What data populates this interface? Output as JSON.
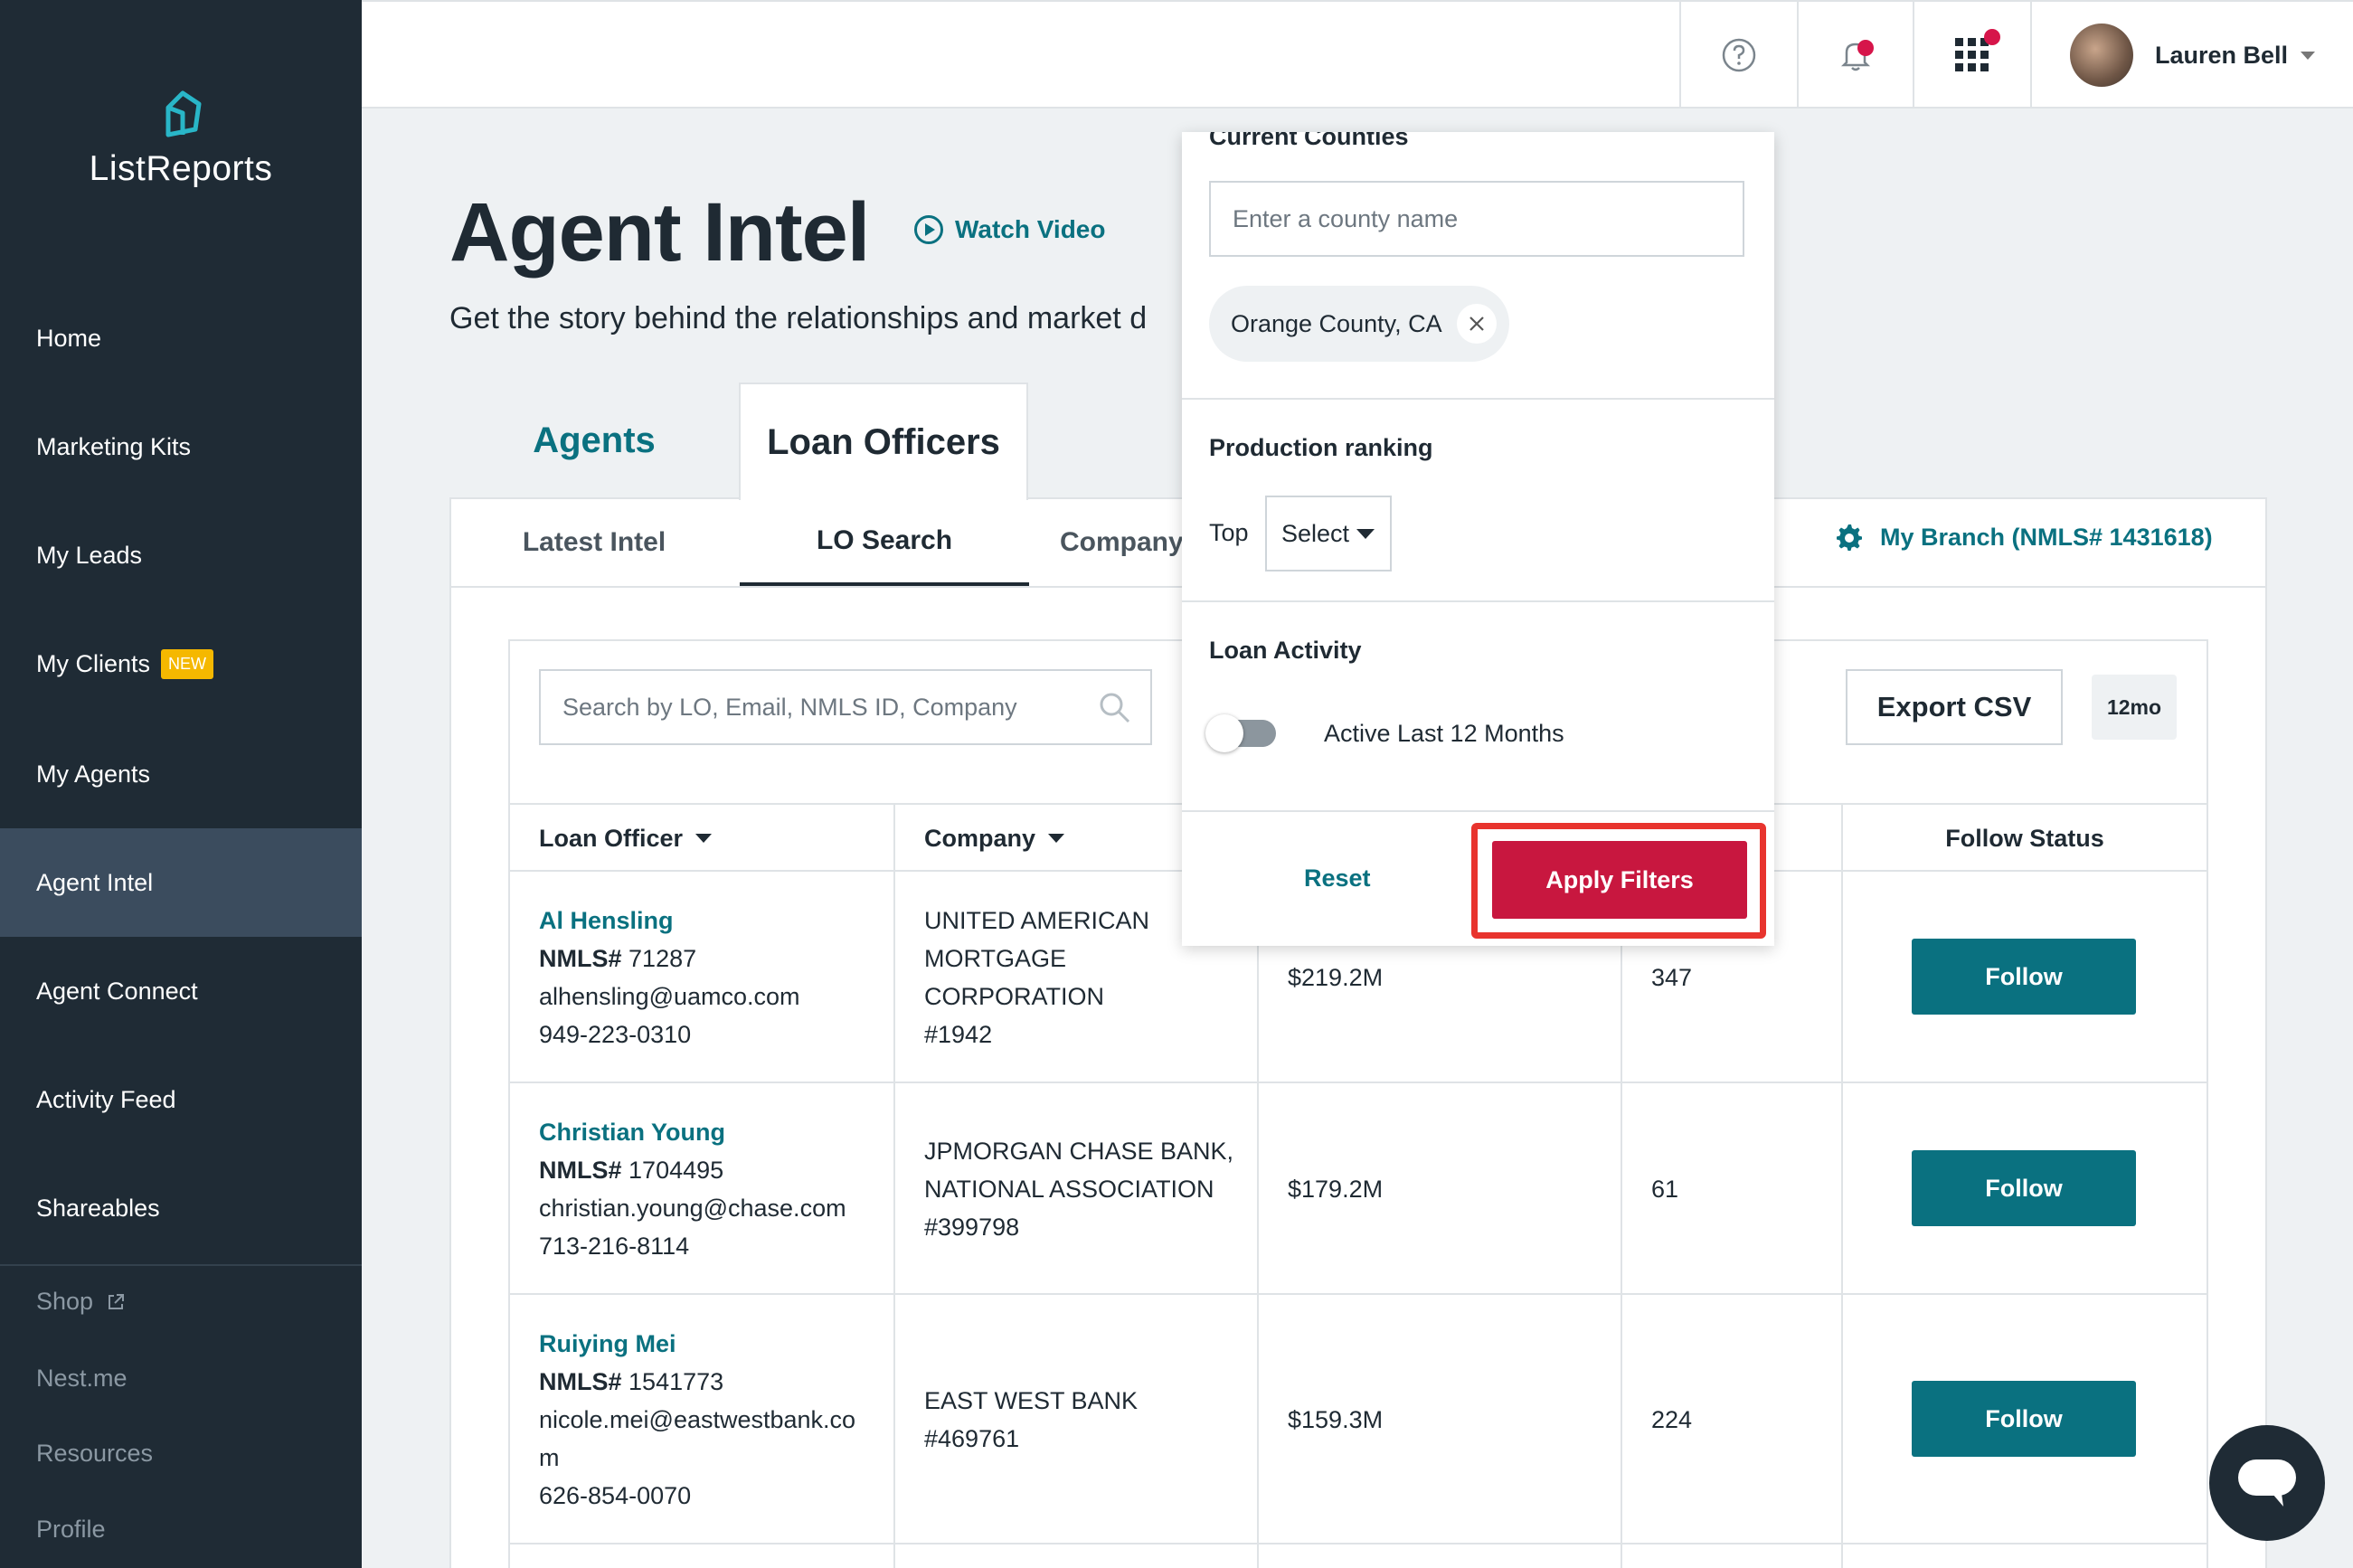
{
  "app": {
    "logo_text": "ListReports"
  },
  "sidebar": {
    "items": [
      {
        "label": "Home"
      },
      {
        "label": "Marketing Kits"
      },
      {
        "label": "My Leads"
      },
      {
        "label": "My Clients",
        "badge": "NEW"
      },
      {
        "label": "My Agents"
      },
      {
        "label": "Agent Intel",
        "active": true
      },
      {
        "label": "Agent Connect"
      },
      {
        "label": "Activity Feed"
      },
      {
        "label": "Shareables"
      }
    ],
    "secondary": [
      {
        "label": "Shop",
        "external": true
      },
      {
        "label": "Nest.me"
      },
      {
        "label": "Resources"
      },
      {
        "label": "Profile"
      }
    ]
  },
  "topbar": {
    "user_name": "Lauren Bell",
    "icons": [
      "help-icon",
      "notification-bell-icon",
      "apps-grid-icon"
    ]
  },
  "header": {
    "title": "Agent Intel",
    "watch_video": "Watch Video",
    "subtitle": "Get the story behind the relationships and market d"
  },
  "tabs": {
    "agents": "Agents",
    "loan_officers": "Loan Officers"
  },
  "subtabs": {
    "latest_intel": "Latest Intel",
    "lo_search": "LO Search",
    "company": "Company"
  },
  "branch": {
    "label": "My Branch (NMLS# 1431618)"
  },
  "search": {
    "placeholder": "Search by LO, Email, NMLS ID, Company"
  },
  "toolbar": {
    "export_label": "Export CSV",
    "period": "12mo"
  },
  "table": {
    "headers": {
      "loan_officer": "Loan Officer",
      "company": "Company",
      "follow_status": "Follow Status"
    },
    "rows": [
      {
        "name": "Al Hensling",
        "nmls_prefix": "NMLS#",
        "nmls": "71287",
        "email": "alhensling@uamco.com",
        "phone": "949-223-0310",
        "company_lines": [
          "UNITED AMERICAN",
          "MORTGAGE",
          "CORPORATION",
          "#1942"
        ],
        "volume": "$219.2M",
        "units": "347",
        "follow": "Follow"
      },
      {
        "name": "Christian Young",
        "nmls_prefix": "NMLS#",
        "nmls": "1704495",
        "email": "christian.young@chase.com",
        "phone": "713-216-8114",
        "company_lines": [
          "JPMORGAN CHASE BANK,",
          "NATIONAL ASSOCIATION",
          "#399798"
        ],
        "volume": "$179.2M",
        "units": "61",
        "follow": "Follow"
      },
      {
        "name": "Ruiying Mei",
        "nmls_prefix": "NMLS#",
        "nmls": "1541773",
        "email_lines": [
          "nicole.mei@eastwestbank.co",
          "m"
        ],
        "phone": "626-854-0070",
        "company_lines": [
          "EAST WEST BANK",
          "#469761"
        ],
        "volume": "$159.3M",
        "units": "224",
        "follow": "Follow"
      }
    ]
  },
  "filter_dropdown": {
    "counties_heading": "Current Counties",
    "county_placeholder": "Enter a county name",
    "county_chip": "Orange County, CA",
    "production_heading": "Production ranking",
    "top_label": "Top",
    "select_label": "Select",
    "loan_activity_heading": "Loan Activity",
    "toggle_label": "Active Last 12 Months",
    "toggle_on": false,
    "reset_label": "Reset",
    "apply_label": "Apply Filters"
  },
  "colors": {
    "sidebar_bg": "#1f2b35",
    "accent_teal": "#0a7180",
    "apply_red": "#c8173f",
    "highlight_red": "#e8342e",
    "new_badge": "#f5b800"
  }
}
